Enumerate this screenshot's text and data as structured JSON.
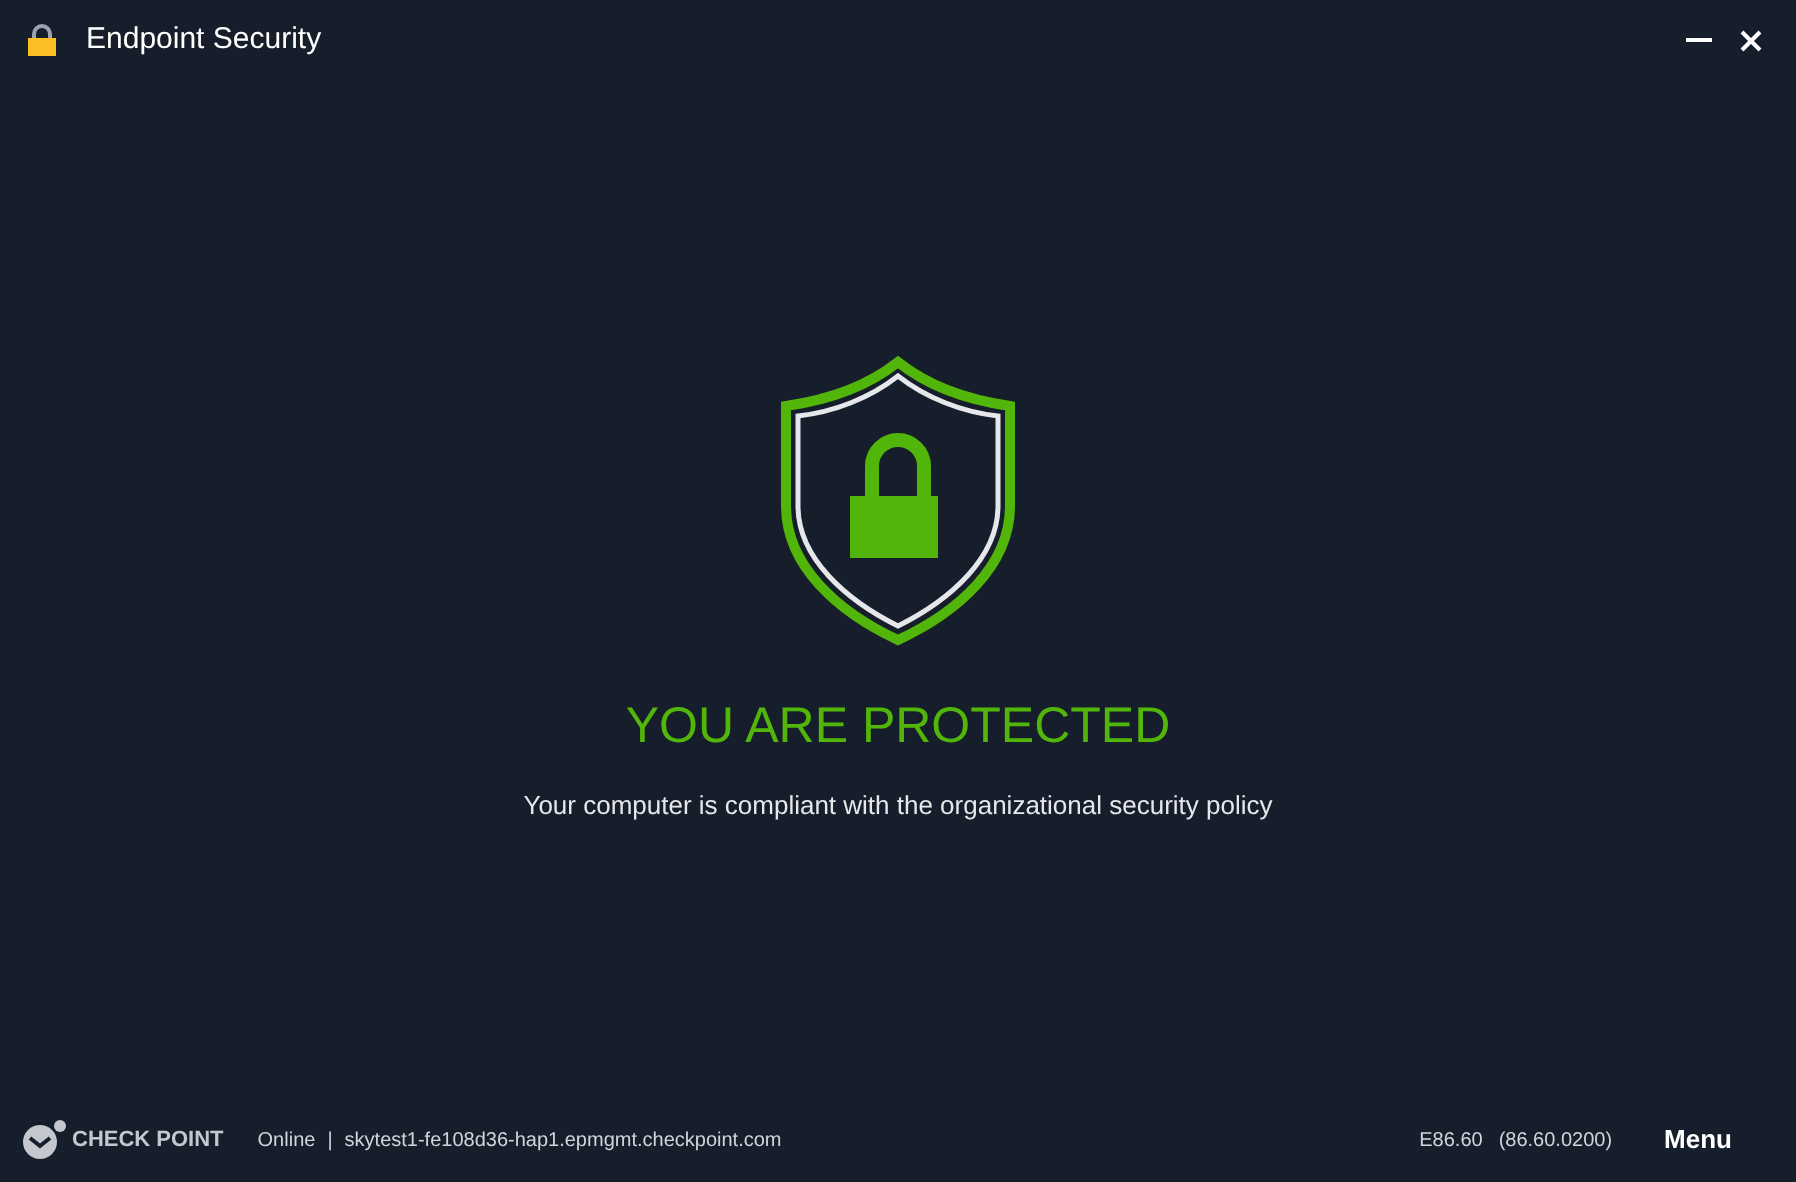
{
  "window": {
    "title": "Endpoint Security"
  },
  "status": {
    "title": "YOU ARE PROTECTED",
    "message": "Your computer is compliant with the organizational security policy"
  },
  "footer": {
    "brand": "CHECK POINT",
    "connection": "Online",
    "separator": "|",
    "server": "skytest1-fe108d36-hap1.epmgmt.checkpoint.com",
    "version": "E86.60",
    "build": "(86.60.0200)",
    "menu": "Menu"
  }
}
